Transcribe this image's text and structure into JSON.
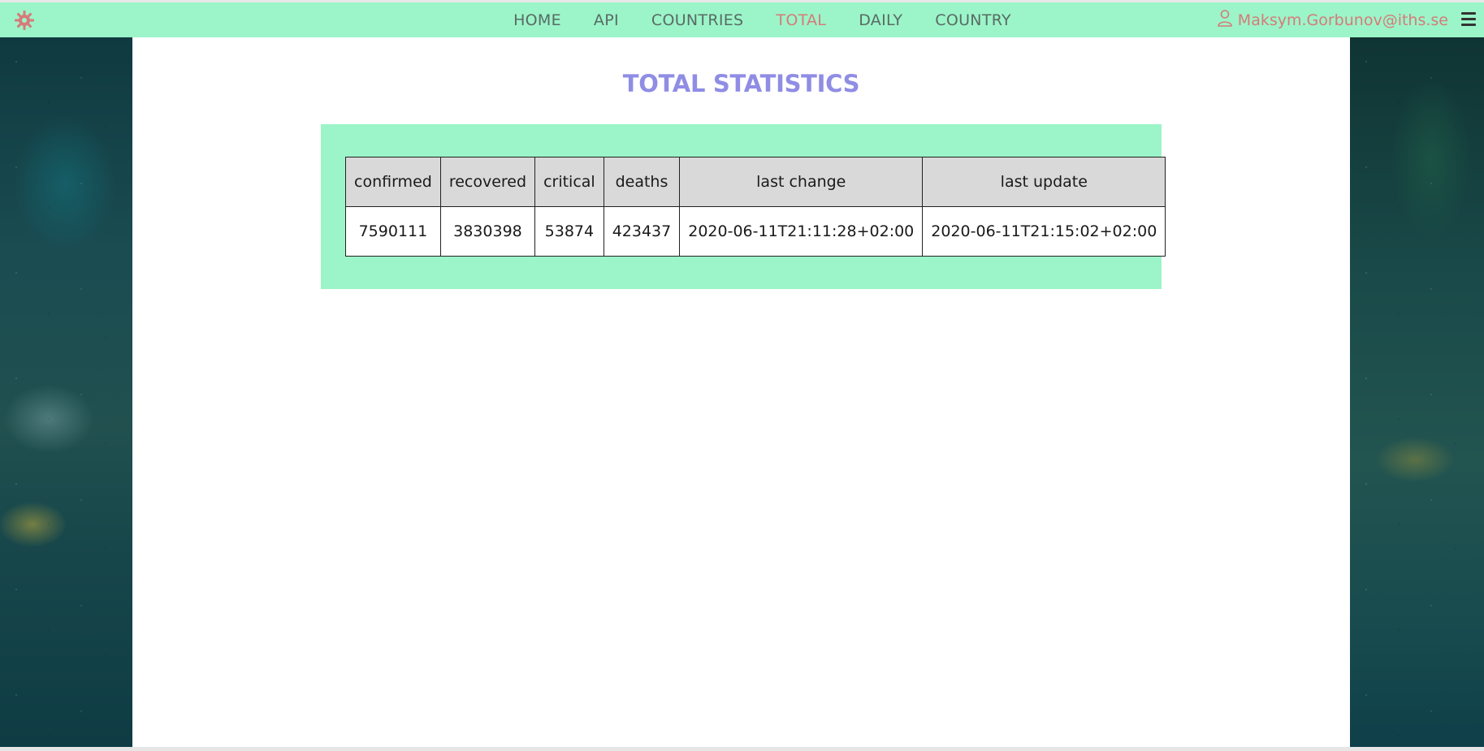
{
  "nav": {
    "items": [
      {
        "label": "HOME"
      },
      {
        "label": "API"
      },
      {
        "label": "COUNTRIES"
      },
      {
        "label": "TOTAL"
      },
      {
        "label": "DAILY"
      },
      {
        "label": "COUNTRY"
      }
    ],
    "active": "TOTAL",
    "user_email": "Maksym.Gorbunov@iths.se",
    "logo_icon": "gear-icon",
    "menu_icon": "hamburger-menu-icon"
  },
  "page": {
    "title": "TOTAL STATISTICS"
  },
  "table": {
    "headers": [
      "confirmed",
      "recovered",
      "critical",
      "deaths",
      "last change",
      "last update"
    ],
    "rows": [
      [
        "7590111",
        "3830398",
        "53874",
        "423437",
        "2020-06-11T21:11:28+02:00",
        "2020-06-11T21:15:02+02:00"
      ]
    ]
  },
  "colors": {
    "navbar": "#9bf5c8",
    "active_link": "#d77a7a",
    "title": "#8f8de4",
    "panel": "#9bf5c8",
    "header_cell": "#d9d9d9"
  }
}
